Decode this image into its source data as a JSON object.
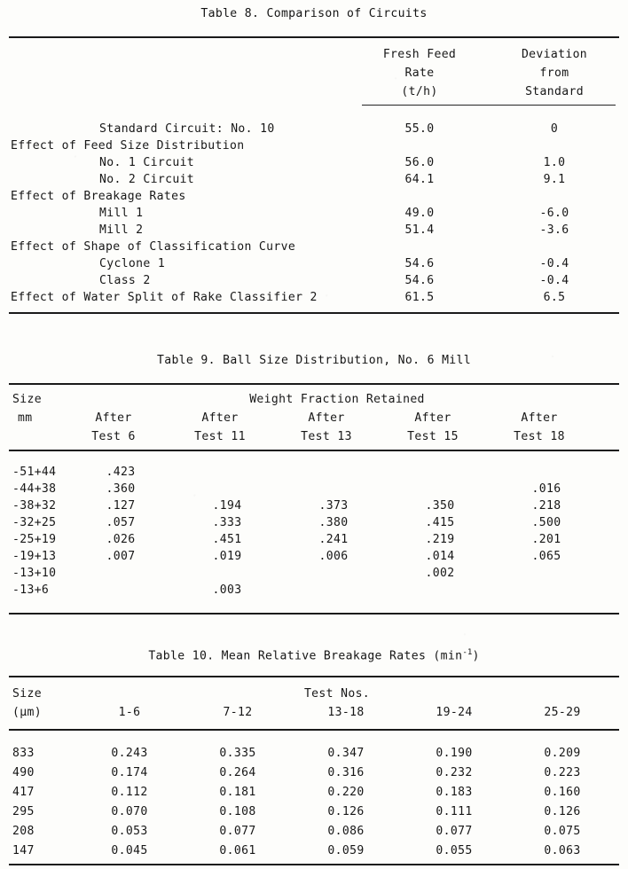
{
  "table8": {
    "caption": "Table 8. Comparison of Circuits",
    "columns": [
      {
        "lines": [
          "Fresh Feed",
          "Rate",
          "(t/h)"
        ]
      },
      {
        "lines": [
          "Deviation",
          "from",
          "Standard"
        ]
      }
    ],
    "rows": [
      {
        "label": "Standard Circuit: No. 10",
        "indent": "sub",
        "rate": "55.0",
        "deviation": "0"
      },
      {
        "label": "Effect of Feed Size Distribution",
        "indent": "main",
        "rate": "",
        "deviation": ""
      },
      {
        "label": "No. 1 Circuit",
        "indent": "sub",
        "rate": "56.0",
        "deviation": "1.0"
      },
      {
        "label": "No. 2 Circuit",
        "indent": "sub",
        "rate": "64.1",
        "deviation": "9.1"
      },
      {
        "label": "Effect of Breakage Rates",
        "indent": "main",
        "rate": "",
        "deviation": ""
      },
      {
        "label": "Mill 1",
        "indent": "sub",
        "rate": "49.0",
        "deviation": "-6.0"
      },
      {
        "label": "Mill 2",
        "indent": "sub",
        "rate": "51.4",
        "deviation": "-3.6"
      },
      {
        "label": "Effect of Shape of Classification Curve",
        "indent": "main",
        "rate": "",
        "deviation": ""
      },
      {
        "label": "Cyclone 1",
        "indent": "sub",
        "rate": "54.6",
        "deviation": "-0.4"
      },
      {
        "label": "Class 2",
        "indent": "sub",
        "rate": "54.6",
        "deviation": "-0.4"
      },
      {
        "label": "Effect of Water Split of Rake Classifier 2",
        "indent": "main",
        "rate": "61.5",
        "deviation": "6.5"
      }
    ]
  },
  "table9": {
    "caption": "Table 9. Ball Size Distribution, No. 6 Mill",
    "size_header": [
      "Size",
      "mm"
    ],
    "span_header": "Weight Fraction Retained",
    "columns": [
      {
        "lines": [
          "After",
          "Test 6"
        ]
      },
      {
        "lines": [
          "After",
          "Test 11"
        ]
      },
      {
        "lines": [
          "After",
          "Test 13"
        ]
      },
      {
        "lines": [
          "After",
          "Test 15"
        ]
      },
      {
        "lines": [
          "After",
          "Test 18"
        ]
      }
    ],
    "rows": [
      {
        "size": "-51+44",
        "values": [
          ".423",
          "",
          "",
          "",
          ""
        ]
      },
      {
        "size": "-44+38",
        "values": [
          ".360",
          "",
          "",
          "",
          ".016"
        ]
      },
      {
        "size": "-38+32",
        "values": [
          ".127",
          ".194",
          ".373",
          ".350",
          ".218"
        ]
      },
      {
        "size": "-32+25",
        "values": [
          ".057",
          ".333",
          ".380",
          ".415",
          ".500"
        ]
      },
      {
        "size": "-25+19",
        "values": [
          ".026",
          ".451",
          ".241",
          ".219",
          ".201"
        ]
      },
      {
        "size": "-19+13",
        "values": [
          ".007",
          ".019",
          ".006",
          ".014",
          ".065"
        ]
      },
      {
        "size": "-13+10",
        "values": [
          "",
          "",
          "",
          ".002",
          ""
        ]
      },
      {
        "size": "-13+6",
        "values": [
          "",
          ".003",
          "",
          "",
          ""
        ]
      }
    ]
  },
  "table10": {
    "caption_prefix": "Table 10. Mean Relative Breakage Rates (min",
    "caption_superscript": "-1",
    "caption_suffix": ")",
    "size_header": [
      "Size",
      "(µm)"
    ],
    "span_header": "Test Nos.",
    "columns": [
      {
        "label": "1-6"
      },
      {
        "label": "7-12"
      },
      {
        "label": "13-18"
      },
      {
        "label": "19-24"
      },
      {
        "label": "25-29"
      }
    ],
    "rows": [
      {
        "size": "833",
        "values": [
          "0.243",
          "0.335",
          "0.347",
          "0.190",
          "0.209"
        ]
      },
      {
        "size": "490",
        "values": [
          "0.174",
          "0.264",
          "0.316",
          "0.232",
          "0.223"
        ]
      },
      {
        "size": "417",
        "values": [
          "0.112",
          "0.181",
          "0.220",
          "0.183",
          "0.160"
        ]
      },
      {
        "size": "295",
        "values": [
          "0.070",
          "0.108",
          "0.126",
          "0.111",
          "0.126"
        ]
      },
      {
        "size": "208",
        "values": [
          "0.053",
          "0.077",
          "0.086",
          "0.077",
          "0.075"
        ]
      },
      {
        "size": "147",
        "values": [
          "0.045",
          "0.061",
          "0.059",
          "0.055",
          "0.063"
        ]
      }
    ]
  }
}
